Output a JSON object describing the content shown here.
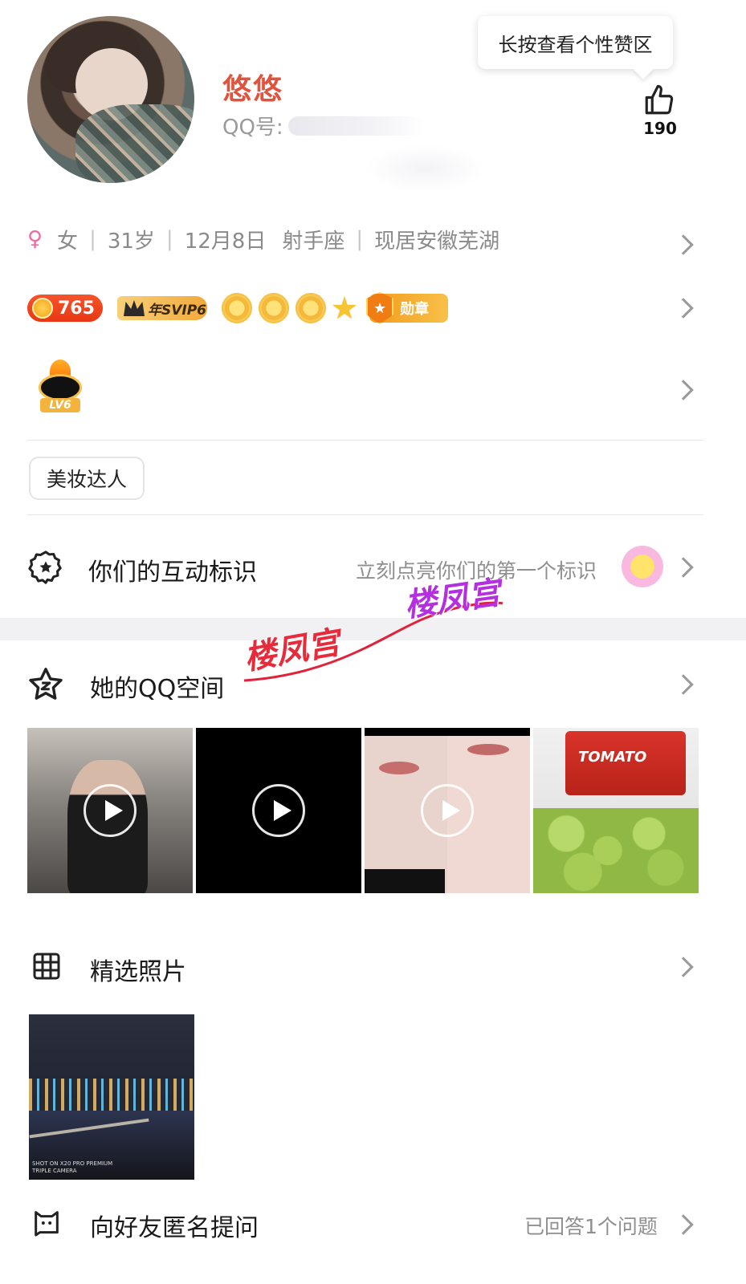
{
  "profile": {
    "nickname": "悠悠",
    "qq_label": "QQ号:"
  },
  "like": {
    "tooltip": "长按查看个性赞区",
    "count": "190"
  },
  "info": {
    "gender_symbol": "♀",
    "gender": "女",
    "age": "31岁",
    "birthday": "12月8日",
    "zodiac": "射手座",
    "location": "现居安徽芜湖",
    "separator": "|"
  },
  "badges": {
    "coin_value": "765",
    "svip_label": "年SVIP6",
    "medal_label": "勋章",
    "level_badge": "LV6"
  },
  "tag_chip": "美妆达人",
  "interaction": {
    "title": "你们的互动标识",
    "hint": "立刻点亮你们的第一个标识"
  },
  "qzone": {
    "title": "她的QQ空间",
    "tomato_label": "TOMATO"
  },
  "featured": {
    "title": "精选照片",
    "photo_caption_1": "SHOT ON X20 PRO PREMIUM",
    "photo_caption_2": "TRIPLE CAMERA"
  },
  "anon_question": {
    "title": "向好友匿名提问",
    "hint": "已回答1个问题"
  },
  "watermark": {
    "text_red": "楼凤宫",
    "text_purple": "楼凤宫"
  },
  "colors": {
    "nickname": "#e0533d",
    "female": "#f06aa0",
    "watermark_red": "#e82b3b",
    "watermark_purple": "#b42fe0"
  }
}
